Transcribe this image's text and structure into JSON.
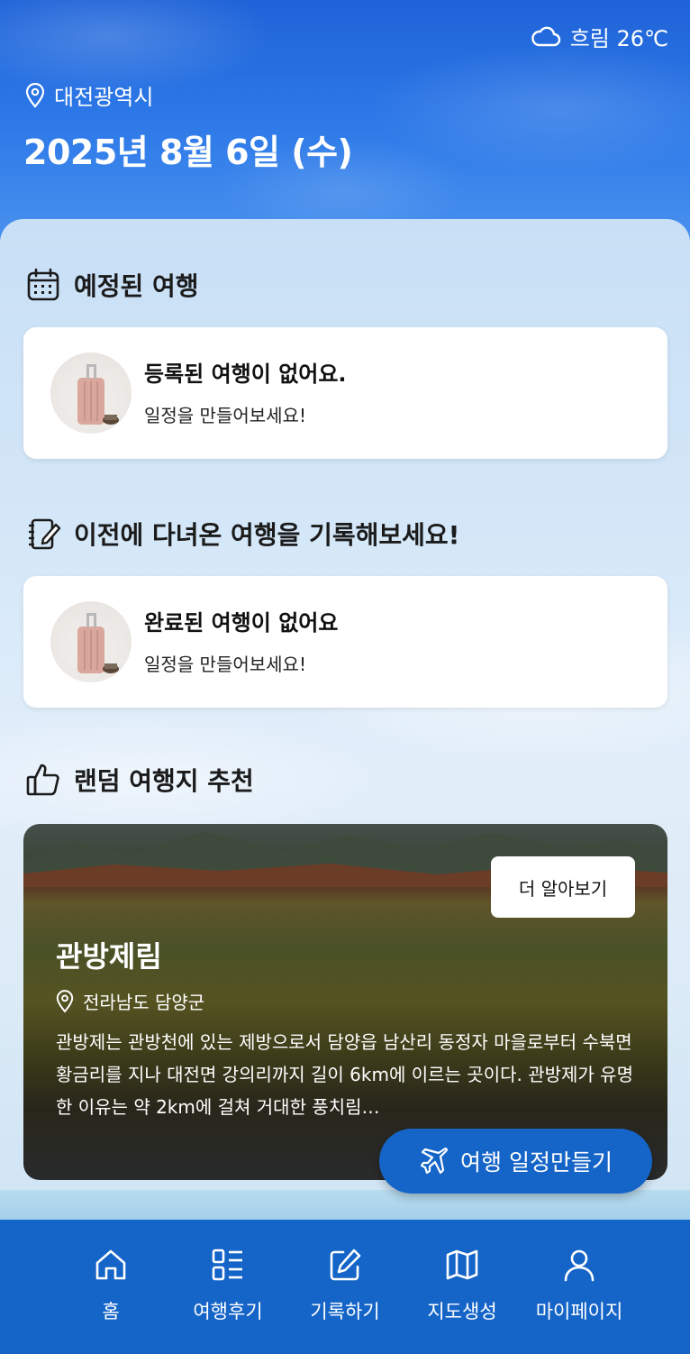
{
  "weather": {
    "icon": "cloud-icon",
    "text": "흐림 26℃"
  },
  "location": {
    "icon": "location-pin-icon",
    "city": "대전광역시"
  },
  "date_title": "2025년 8월 6일 (수)",
  "upcoming": {
    "icon": "calendar-icon",
    "header": "예정된 여행",
    "card": {
      "image": "suitcase-image",
      "title": "등록된 여행이 없어요.",
      "subtitle": "일정을 만들어보세요!"
    }
  },
  "past": {
    "icon": "notebook-pen-icon",
    "header": "이전에 다녀온 여행을 기록해보세요!",
    "card": {
      "image": "suitcase-image",
      "title": "완료된 여행이 없어요",
      "subtitle": "일정을 만들어보세요!"
    }
  },
  "recommend": {
    "icon": "thumbs-up-icon",
    "header": "랜덤 여행지 추천",
    "more_button": "더 알아보기",
    "name": "관방제림",
    "location": "전라남도 담양군",
    "description": "관방제는 관방천에 있는 제방으로서 담양읍 남산리 동정자 마을로부터 수북면 황금리를 지나 대전면 강의리까지 길이 6km에 이르는 곳이다. 관방제가 유명한 이유는 약 2km에 걸쳐 거대한 풍치림…"
  },
  "fab": {
    "icon": "airplane-icon",
    "label": "여행 일정만들기"
  },
  "nav": [
    {
      "icon": "home-icon",
      "label": "홈"
    },
    {
      "icon": "list-icon",
      "label": "여행후기"
    },
    {
      "icon": "edit-icon",
      "label": "기록하기"
    },
    {
      "icon": "map-icon",
      "label": "지도생성"
    },
    {
      "icon": "user-icon",
      "label": "마이페이지"
    }
  ],
  "colors": {
    "primary": "#1565c8",
    "header_bg": "#2d79e8"
  }
}
